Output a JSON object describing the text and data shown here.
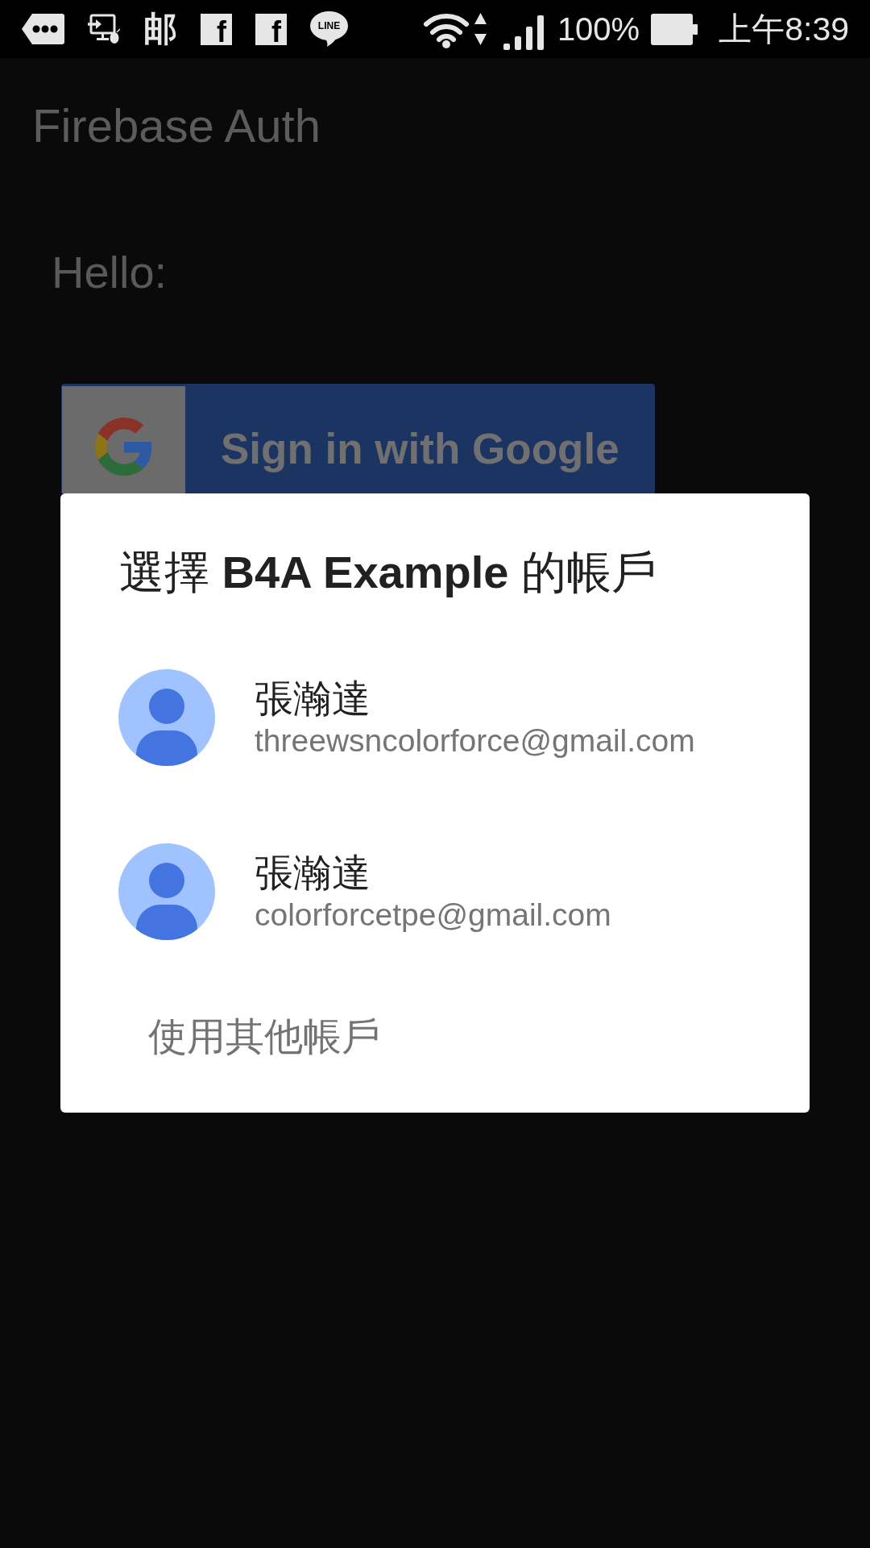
{
  "status_bar": {
    "notifications": [
      {
        "kind": "tag"
      },
      {
        "kind": "remote"
      },
      {
        "kind": "glyph",
        "glyph": "邮"
      },
      {
        "kind": "square",
        "glyph": "f"
      },
      {
        "kind": "square",
        "glyph": "f"
      },
      {
        "kind": "bubble",
        "glyph": "LINE"
      }
    ],
    "battery": "100%",
    "time": "上午8:39"
  },
  "app_bar": {
    "title": "Firebase Auth"
  },
  "content": {
    "greeting": "Hello:",
    "sign_in_button": {
      "label": "Sign in with Google"
    }
  },
  "dialog": {
    "title": "選擇 **B4A Example** 的帳戶",
    "accounts": [
      {
        "name": "張瀚達",
        "email": "threewsncolorforce@gmail.com"
      },
      {
        "name": "張瀚達",
        "email": "colorforcetpe@gmail.com"
      }
    ],
    "other_account": "使用其他帳戶"
  }
}
